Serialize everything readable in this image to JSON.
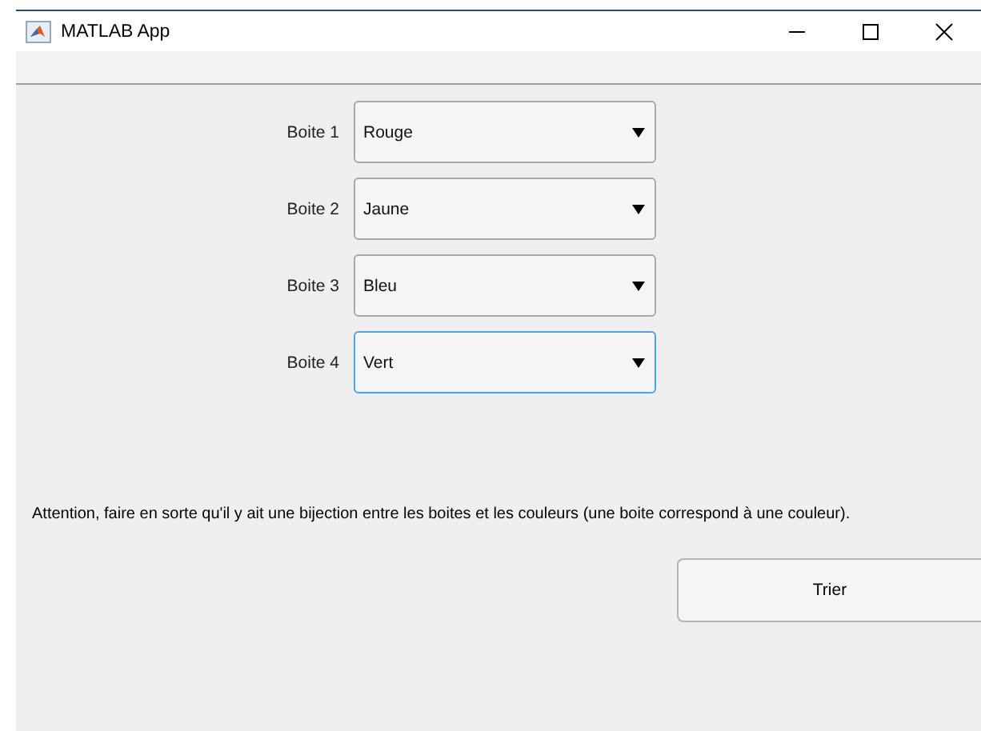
{
  "window": {
    "title": "MATLAB App"
  },
  "dropdowns": [
    {
      "label": "Boite 1",
      "value": "Rouge",
      "focused": false
    },
    {
      "label": "Boite 2",
      "value": "Jaune",
      "focused": false
    },
    {
      "label": "Boite 3",
      "value": "Bleu",
      "focused": false
    },
    {
      "label": "Boite 4",
      "value": "Vert",
      "focused": true
    }
  ],
  "message": "Attention, faire en sorte qu'il y ait une bijection entre les boites et les couleurs (une boite correspond à une couleur).",
  "button": {
    "label": "Trier"
  }
}
